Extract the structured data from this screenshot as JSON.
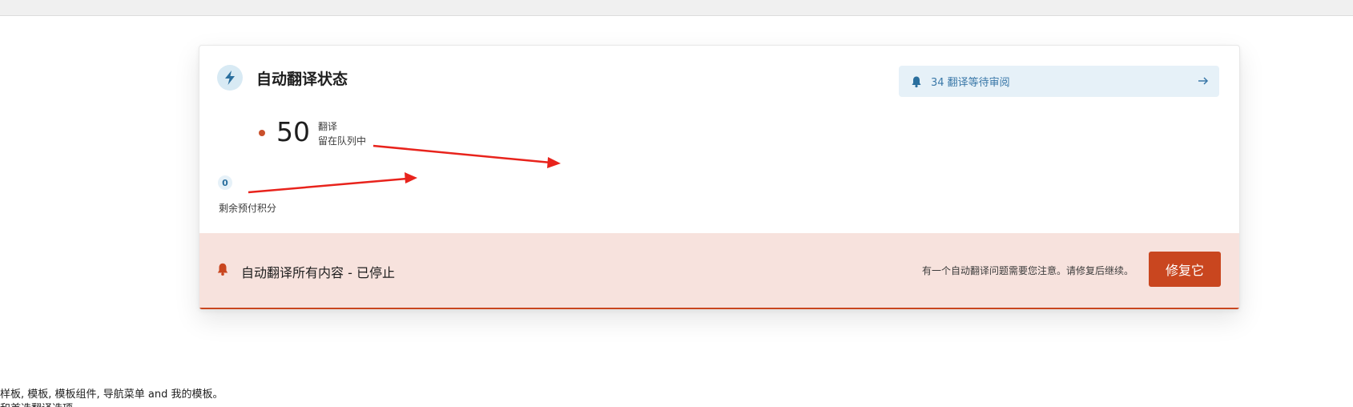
{
  "card": {
    "title": "自动翻译状态",
    "review_banner": {
      "text": "34 翻译等待审阅"
    },
    "queue": {
      "count": "50",
      "label_line1": "翻译",
      "label_line2": "留在队列中"
    },
    "credits": {
      "value": "0",
      "label": "剩余预付积分"
    },
    "status": {
      "text": "自动翻译所有内容 - 已停止",
      "notice": "有一个自动翻译问题需要您注意。请修复后继续。",
      "fix_label": "修复它"
    }
  },
  "bottom_text": {
    "line1": "样板, 模板, 模板组件, 导航菜单 and 我的模板。",
    "line2": "和首选翻译选项。"
  },
  "icons": [
    "lightning-icon",
    "bell-icon",
    "arrow-right-icon",
    "annotation-arrow"
  ],
  "colors": {
    "accent_blue": "#3a78a8",
    "banner_blue_bg": "#e6f1f8",
    "alert_red": "#c9461f",
    "alert_bg": "#f7e2dd",
    "annotation_red": "#e8231c"
  }
}
